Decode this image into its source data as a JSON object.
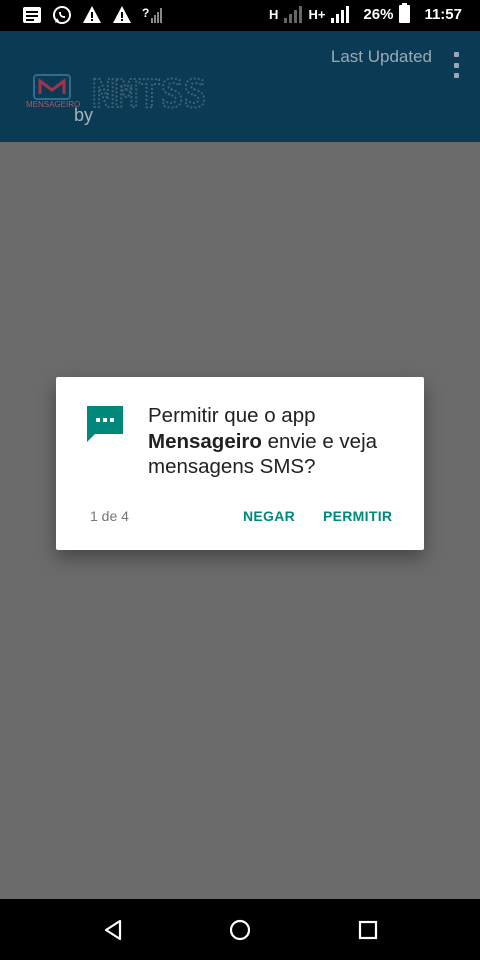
{
  "status_bar": {
    "net1": "H",
    "net2": "H+",
    "battery": "26%",
    "time": "11:57",
    "icons": [
      "news-notification-icon",
      "whatsapp-icon",
      "alert-icon",
      "alert-icon",
      "no-sim-signal-icon"
    ]
  },
  "app_bar": {
    "last_updated_label": "Last Updated",
    "logo_word": "MENSAGEIRO",
    "by_label": "by",
    "brand_name": "NMTSS"
  },
  "dialog": {
    "text_part1": "Permitir que o app ",
    "app_name": "Mensageiro",
    "text_part2": " envie e veja mensagens SMS?",
    "counter": "1 de 4",
    "deny_label": "NEGAR",
    "allow_label": "PERMITIR",
    "icon": "sms-icon",
    "accent_color": "#00897b"
  },
  "nav_bar": {
    "icons": [
      "back-icon",
      "home-icon",
      "recents-icon"
    ]
  }
}
